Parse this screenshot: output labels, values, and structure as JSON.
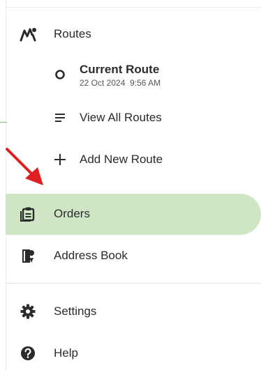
{
  "nav": {
    "routes": {
      "label": "Routes",
      "icon": "routes-icon"
    },
    "current_route": {
      "label": "Current Route",
      "date": "22 Oct 2024",
      "time": "9:56 AM",
      "icon": "circle-icon"
    },
    "view_all_routes": {
      "label": "View All Routes",
      "icon": "list-icon"
    },
    "add_new_route": {
      "label": "Add New Route",
      "icon": "plus-icon"
    },
    "orders": {
      "label": "Orders",
      "icon": "clipboard-icon",
      "active": true
    },
    "address_book": {
      "label": "Address Book",
      "icon": "address-book-icon"
    },
    "settings": {
      "label": "Settings",
      "icon": "gear-icon"
    },
    "help": {
      "label": "Help",
      "icon": "help-icon"
    }
  },
  "colors": {
    "active_background": "#cfe6c5",
    "annotation_arrow": "#e02020",
    "icon": "#2b2b2b"
  }
}
